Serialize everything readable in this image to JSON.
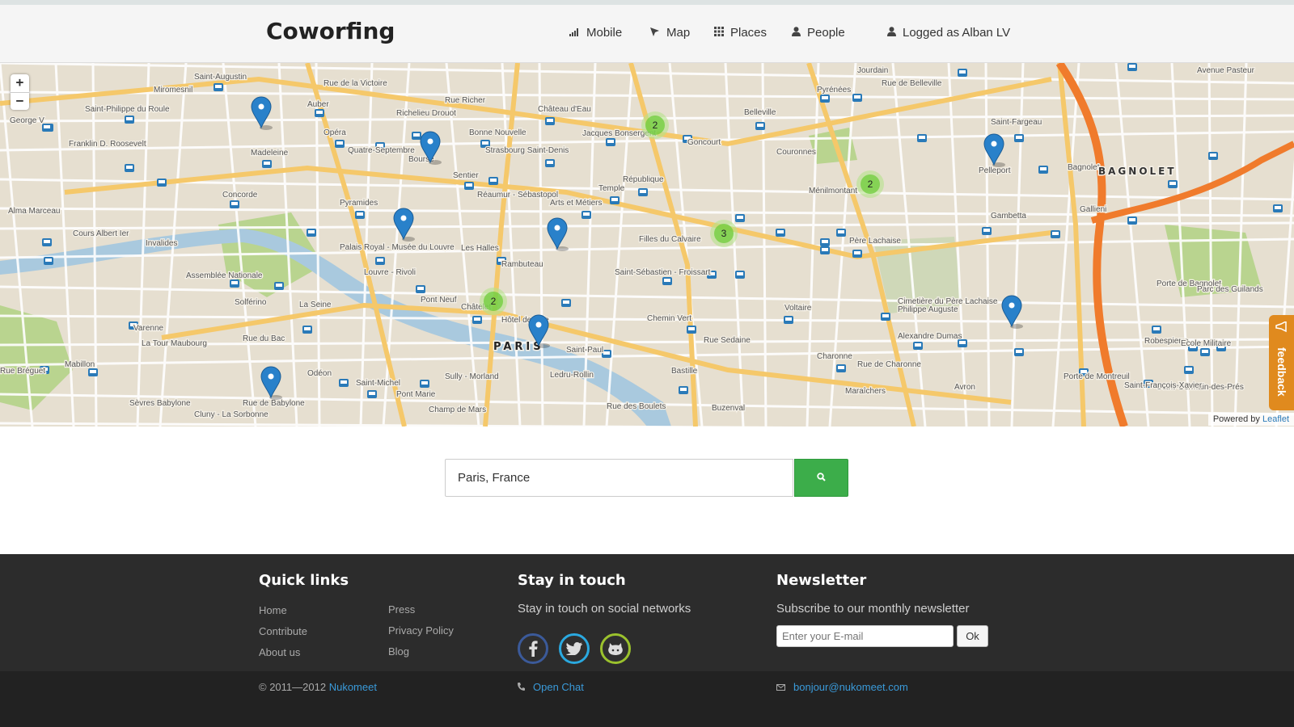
{
  "header": {
    "brand": "Coworfing",
    "nav": {
      "mobile": "Mobile",
      "map": "Map",
      "places": "Places",
      "people": "People",
      "user": "Logged as Alban LV"
    }
  },
  "map": {
    "zoom_in": "+",
    "zoom_out": "−",
    "city_label": "PARIS",
    "district_label": "BAGNOLET",
    "clusters": [
      {
        "label": "2"
      },
      {
        "label": "2"
      },
      {
        "label": "3"
      },
      {
        "label": "2"
      }
    ],
    "street_labels": [
      "Saint-Augustin",
      "Miromesnil",
      "Rue de la Victoire",
      "Rue Richer",
      "Château d'Eau",
      "Belleville",
      "Pyrénées",
      "Jourdain",
      "Rue de Belleville",
      "Avenue Pasteur",
      "Saint-Philippe du Roule",
      "Auber",
      "Richelieu Drouot",
      "Bonne Nouvelle",
      "Jacques Bonsergent",
      "Goncourt",
      "Couronnes",
      "Saint-Fargeau",
      "George V",
      "Franklin D. Roosevelt",
      "Madeleine",
      "Opéra",
      "Quatre-Septembre",
      "Strasbourg Saint-Denis",
      "Bourse",
      "Sentier",
      "République",
      "Ménilmontant",
      "Pelleport",
      "Gambetta",
      "Concorde",
      "Pyramides",
      "Réaumur - Sébastopol",
      "Temple",
      "Arts et Métiers",
      "Filles du Calvaire",
      "Père Lachaise",
      "Gallieni",
      "Bagnolet",
      "Alma Marceau",
      "Cours Albert Ier",
      "Invalides",
      "Palais Royal - Musée du Louvre",
      "Les Halles",
      "Rambuteau",
      "Saint-Sébastien - Froissart",
      "Porte de Bagnolet",
      "Assemblée Nationale",
      "Louvre - Rivoli",
      "Pont Neuf",
      "Châtelet",
      "Hôtel de Ville",
      "Chemin Vert",
      "Voltaire",
      "Cimetière du Père Lachaise",
      "Philippe Auguste",
      "Parc des Guilands",
      "Solférino",
      "La Seine",
      "Alexandre Dumas",
      "Robespierre",
      "Varenne",
      "La Tour Maubourg",
      "Rue du Bac",
      "Saint-Paul",
      "Bastille",
      "Charonne",
      "Rue de Charonne",
      "Porte de Montreuil",
      "Ecole Militaire",
      "Saint-Germain-des-Prés",
      "Mabillon",
      "Odéon",
      "Saint-Michel",
      "Pont Marie",
      "Sully - Morland",
      "Ledru-Rollin",
      "Rue des Boulets",
      "Buzenval",
      "Maraîchers",
      "Avron",
      "Saint-François-Xavier",
      "Sèvres Babylone",
      "Rue de Babylone",
      "Cluny - La Sorbonne",
      "Champ de Mars",
      "Rue Bréguet",
      "Rue Sedaine"
    ],
    "attribution_prefix": "Powered by",
    "attribution_link": "Leaflet",
    "feedback_label": "feedback"
  },
  "search": {
    "value": "Paris, France",
    "icon": "search-icon"
  },
  "footer": {
    "quick_links": {
      "heading": "Quick links",
      "col1": [
        "Home",
        "Contribute",
        "About us"
      ],
      "col2": [
        "Press",
        "Privacy Policy",
        "Blog"
      ]
    },
    "stay_in_touch": {
      "heading": "Stay in touch",
      "text": "Stay in touch on social networks",
      "networks": [
        "facebook-icon",
        "twitter-icon",
        "github-icon"
      ]
    },
    "newsletter": {
      "heading": "Newsletter",
      "text": "Subscribe to our monthly newsletter",
      "placeholder": "Enter your E-mail",
      "button": "Ok"
    }
  },
  "subfooter": {
    "copyright": "© 2011—2012",
    "company": "Nukomeet",
    "chat": "Open Chat",
    "email": "bonjour@nukomeet.com"
  },
  "colors": {
    "accent_green": "#3cad4a",
    "link_blue": "#3a9ad9",
    "marker_blue": "#2981ca",
    "cluster_green": "#8ed04a",
    "feedback_orange": "#e08a1e"
  }
}
